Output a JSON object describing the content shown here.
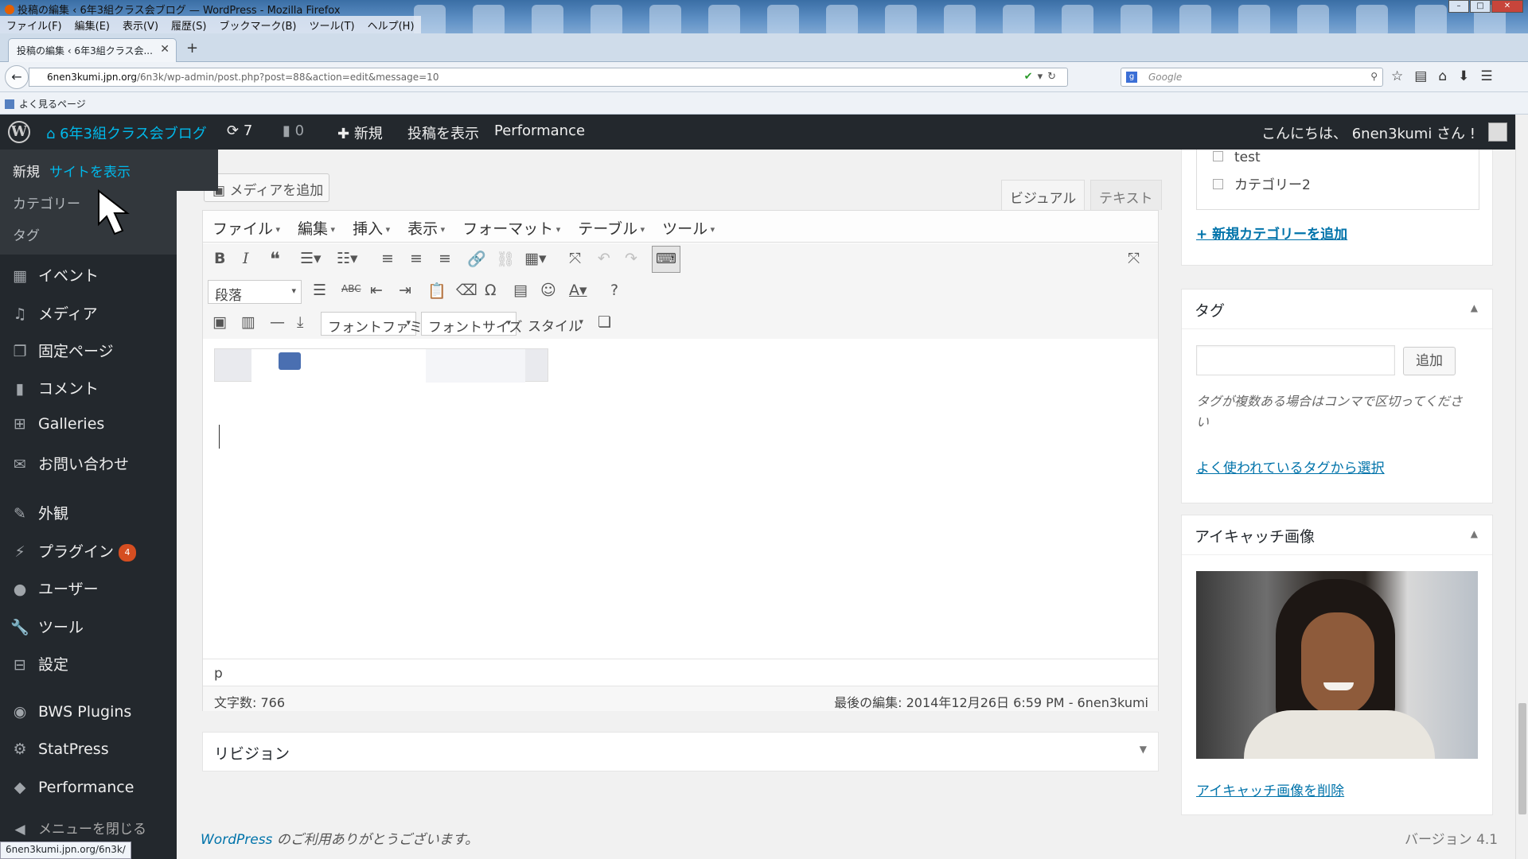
{
  "window": {
    "title": "投稿の編集 ‹ 6年3組クラス会ブログ — WordPress - Mozilla Firefox",
    "menubar": [
      "ファイル(F)",
      "編集(E)",
      "表示(V)",
      "履歴(S)",
      "ブックマーク(B)",
      "ツール(T)",
      "ヘルプ(H)"
    ]
  },
  "browser": {
    "tab_title": "投稿の編集 ‹ 6年3組クラス会...",
    "url_domain": "6nen3kumi.jpn.org",
    "url_prefix": "",
    "url_path": "/6n3k/wp-admin/post.php?post=88&action=edit&message=10",
    "search_placeholder": "Google",
    "bookmark_label": "よく見るページ",
    "status_url": "6nen3kumi.jpn.org/6n3k/"
  },
  "adminbar": {
    "site_name": "6年3組クラス会ブログ",
    "updates_count": "7",
    "comments_count": "0",
    "new_label": "新規",
    "view_post": "投稿を表示",
    "performance": "Performance",
    "greeting": "こんにちは、 6nen3kumi さん !"
  },
  "dropdown": {
    "new_label": "新規",
    "visit_site": "サイトを表示"
  },
  "sidebar": {
    "sub_items": [
      "カテゴリー",
      "タグ"
    ],
    "items": [
      {
        "label": "イベント",
        "icon": "calendar-icon"
      },
      {
        "label": "メディア",
        "icon": "media-icon"
      },
      {
        "label": "固定ページ",
        "icon": "pages-icon"
      },
      {
        "label": "コメント",
        "icon": "comment-icon"
      },
      {
        "label": "Galleries",
        "icon": "grid-icon"
      },
      {
        "label": "お問い合わせ",
        "icon": "mail-icon"
      },
      {
        "label": "外観",
        "icon": "brush-icon"
      },
      {
        "label": "プラグイン",
        "icon": "plugin-icon",
        "badge": "4"
      },
      {
        "label": "ユーザー",
        "icon": "user-icon"
      },
      {
        "label": "ツール",
        "icon": "wrench-icon"
      },
      {
        "label": "設定",
        "icon": "settings-icon"
      },
      {
        "label": "BWS Plugins",
        "icon": "bws-icon"
      },
      {
        "label": "StatPress",
        "icon": "gear-icon"
      },
      {
        "label": "Performance",
        "icon": "performance-icon"
      }
    ],
    "collapse": "メニューを閉じる"
  },
  "editor": {
    "add_media": "メディアを追加",
    "tab_visual": "ビジュアル",
    "tab_text": "テキスト",
    "menu": [
      "ファイル",
      "編集",
      "挿入",
      "表示",
      "フォーマット",
      "テーブル",
      "ツール"
    ],
    "format_select": "段落",
    "font_family": "フォントファミ...",
    "font_size": "フォントサイズ",
    "style": "スタイル",
    "path": "p",
    "word_count": "文字数: 766",
    "last_edited": "最後の編集: 2014年12月26日 6:59 PM - 6nen3kumi"
  },
  "revision": {
    "title": "リビジョン"
  },
  "categories": {
    "items": [
      "test",
      "カテゴリー2"
    ],
    "add_new": "+ 新規カテゴリーを追加"
  },
  "tags": {
    "title": "タグ",
    "add_button": "追加",
    "help": "タグが複数ある場合はコンマで区切ってください",
    "choose_popular": "よく使われているタグから選択"
  },
  "featured": {
    "title": "アイキャッチ画像",
    "remove": "アイキャッチ画像を削除"
  },
  "footer": {
    "wp": "WordPress",
    "thanks": " のご利用ありがとうございます。",
    "version": "バージョン 4.1"
  },
  "colors": {
    "adminbar": "#23282d",
    "link": "#0073aa",
    "highlight": "#00b9eb",
    "badge": "#d54e21"
  }
}
